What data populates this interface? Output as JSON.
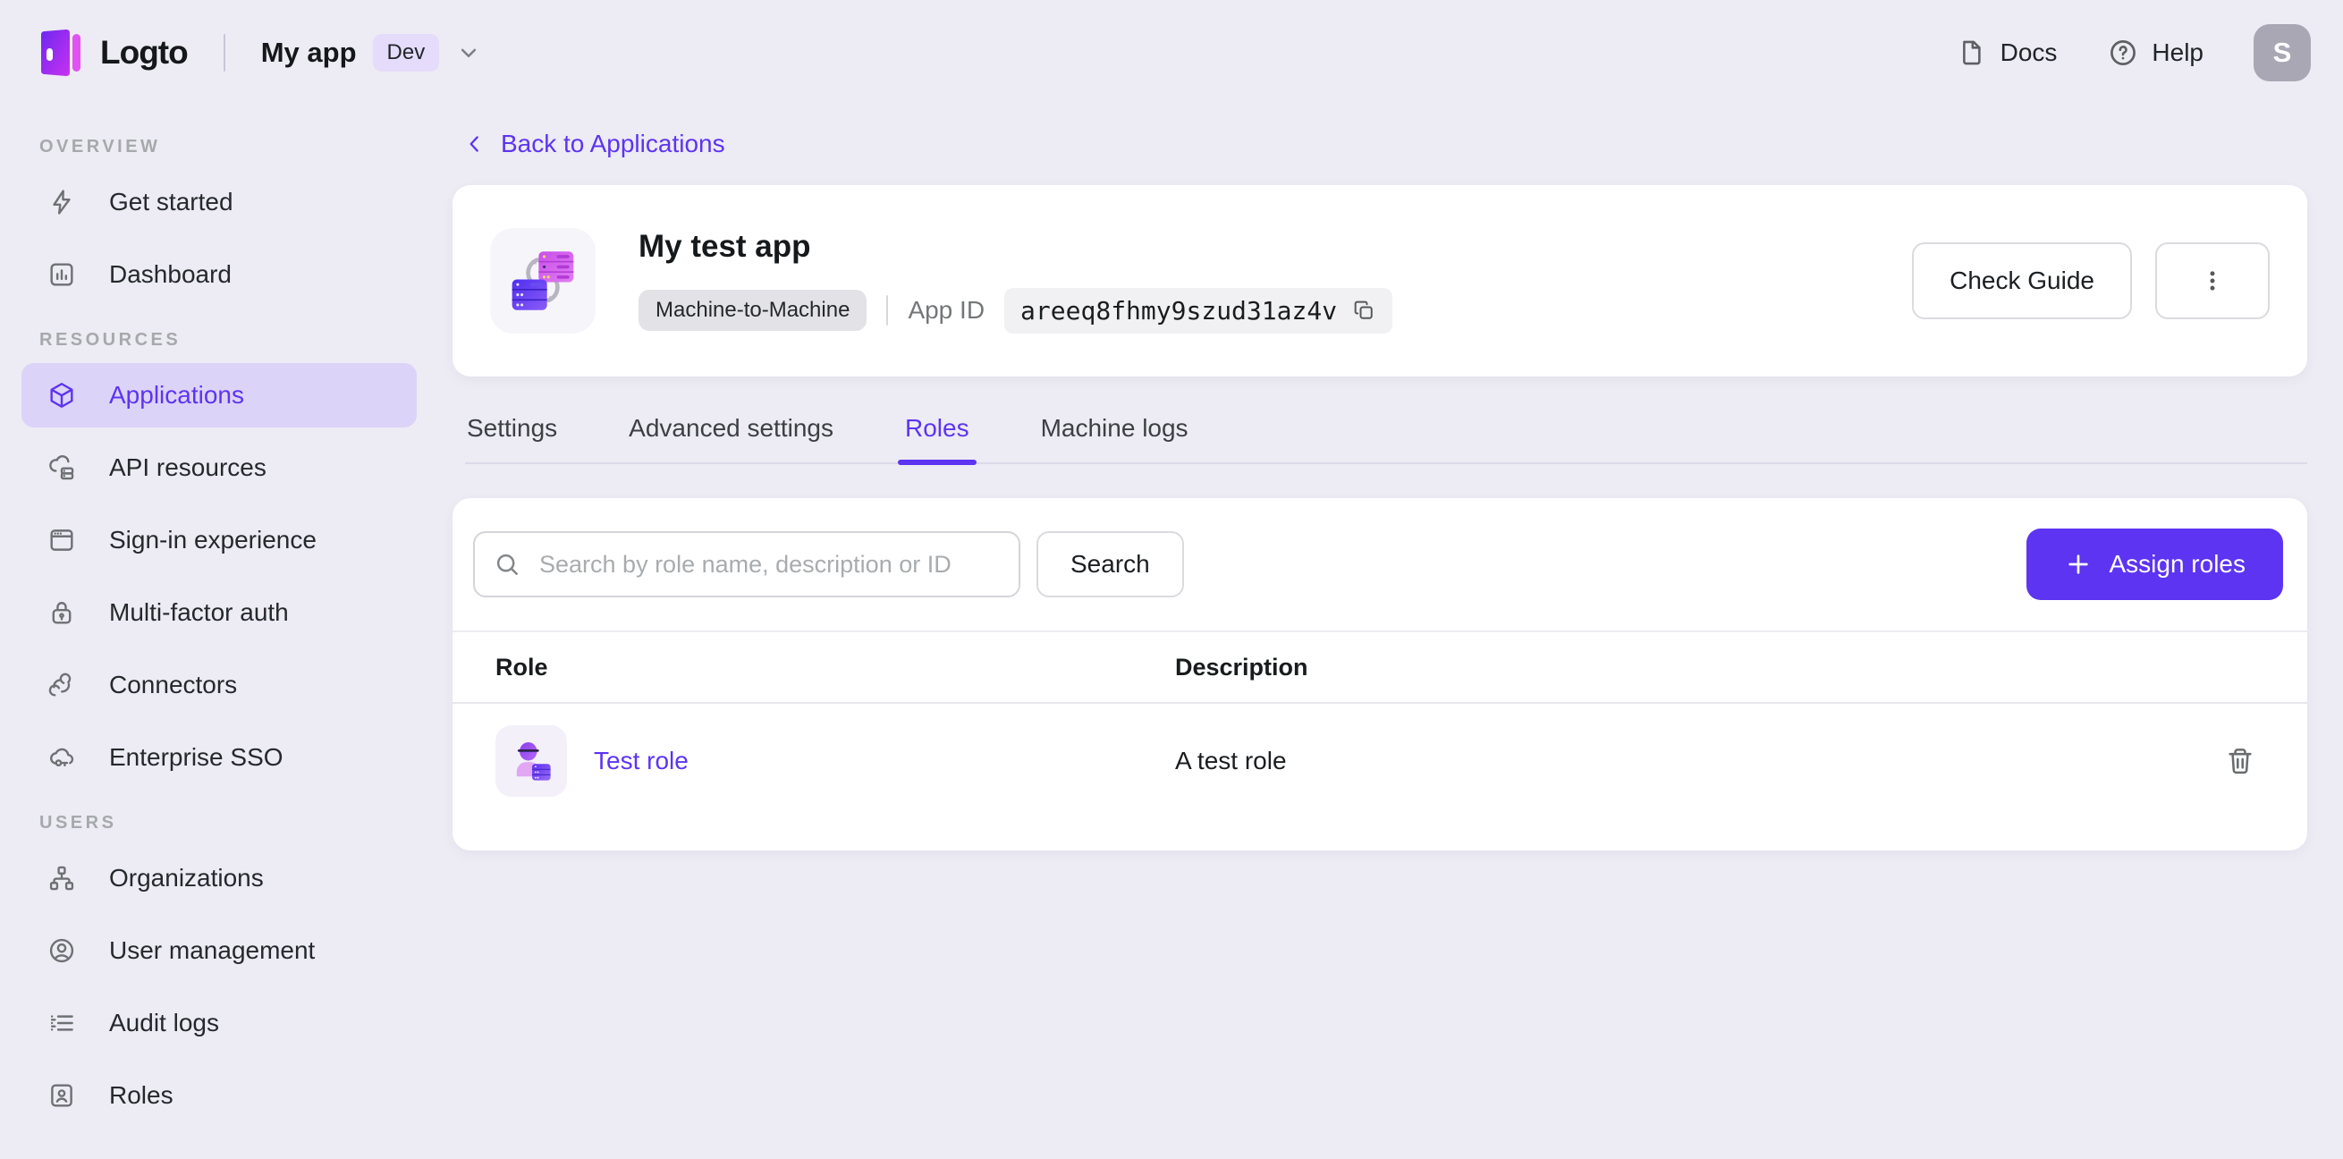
{
  "topbar": {
    "brand": "Logto",
    "tenant": {
      "name": "My app",
      "env_badge": "Dev"
    },
    "links": [
      {
        "label": "Docs"
      },
      {
        "label": "Help"
      }
    ],
    "avatar_initial": "S"
  },
  "sidebar": {
    "sections": [
      {
        "label": "OVERVIEW",
        "items": [
          {
            "label": "Get started"
          },
          {
            "label": "Dashboard"
          }
        ]
      },
      {
        "label": "RESOURCES",
        "items": [
          {
            "label": "Applications",
            "active": true
          },
          {
            "label": "API resources"
          },
          {
            "label": "Sign-in experience"
          },
          {
            "label": "Multi-factor auth"
          },
          {
            "label": "Connectors"
          },
          {
            "label": "Enterprise SSO"
          }
        ]
      },
      {
        "label": "USERS",
        "items": [
          {
            "label": "Organizations"
          },
          {
            "label": "User management"
          },
          {
            "label": "Audit logs"
          },
          {
            "label": "Roles"
          }
        ]
      }
    ]
  },
  "main": {
    "back_link": "Back to Applications",
    "app_card": {
      "title": "My test app",
      "type_badge": "Machine-to-Machine",
      "app_id_label": "App ID",
      "app_id": "areeq8fhmy9szud31az4v",
      "check_guide_label": "Check Guide"
    },
    "tabs": [
      {
        "label": "Settings"
      },
      {
        "label": "Advanced settings"
      },
      {
        "label": "Roles",
        "active": true
      },
      {
        "label": "Machine logs"
      }
    ],
    "roles_panel": {
      "search_placeholder": "Search by role name, description or ID",
      "search_button": "Search",
      "assign_button": "Assign roles",
      "table": {
        "columns": [
          "Role",
          "Description"
        ],
        "rows": [
          {
            "role": "Test role",
            "description": "A test role"
          }
        ]
      }
    }
  },
  "colors": {
    "accent": "#5d34f2",
    "accent_light": "#dcd3f8",
    "page_bg": "#edebf4",
    "card_bg": "#ffffff"
  }
}
